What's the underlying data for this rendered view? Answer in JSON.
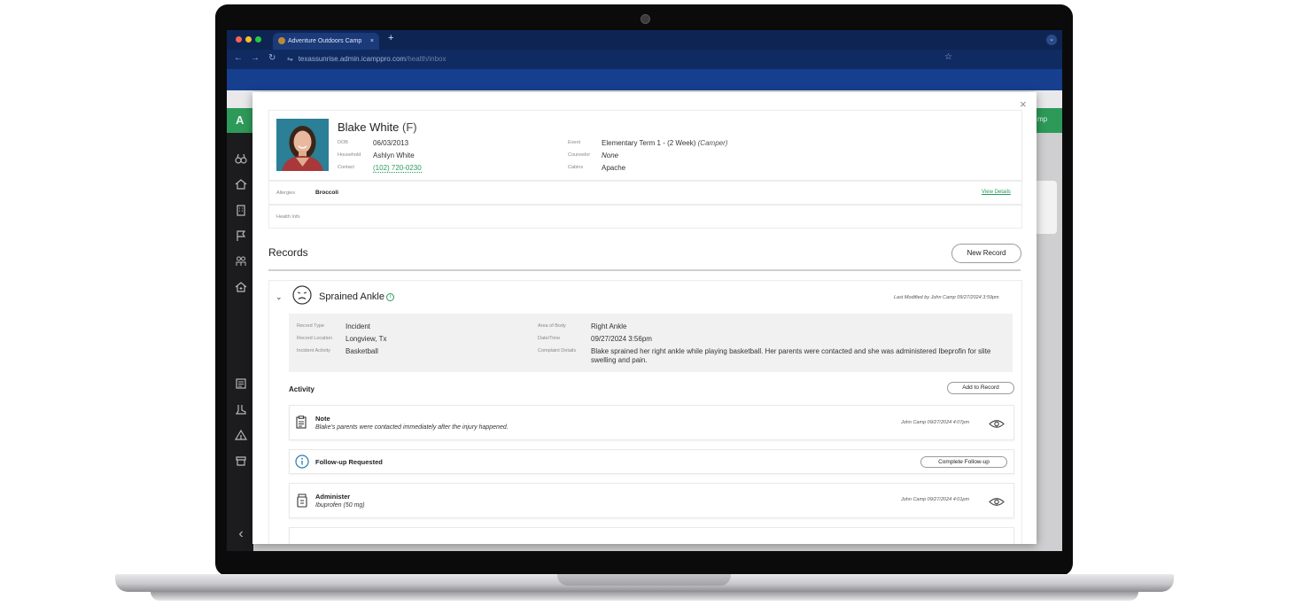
{
  "browser": {
    "tab_title": "Adventure Outdoors Camp",
    "tab_close": "×",
    "new_tab": "+",
    "tab_menu": "⌄",
    "url_host": "texassunrise.admin.icamppro.com",
    "url_path": "/health/inbox",
    "back": "←",
    "forward": "→",
    "reload": "↻",
    "site_info": "⇋",
    "bookmark": "☆"
  },
  "app": {
    "logo_text": "A",
    "header_right": "mp"
  },
  "modal": {
    "close_label": "×",
    "camper": {
      "name": "Blake White",
      "gender": "(F)",
      "dob_label": "DOB",
      "dob": "06/03/2013",
      "household_label": "Household",
      "household": "Ashlyn White",
      "contact_label": "Contact",
      "contact": "(102) 720-0230",
      "event_label": "Event",
      "event": "Elementary Term 1 - (2 Week)",
      "event_role": "(Camper)",
      "counselor_label": "Counselor",
      "counselor": "None",
      "cabins_label": "Cabins",
      "cabins": "Apache"
    },
    "allergies": {
      "label": "Allergies",
      "value": "Broccoli",
      "link": "View Details"
    },
    "health_info_label": "Health Info",
    "records_title": "Records",
    "new_record_label": "New Record",
    "record": {
      "chevron": "⌄",
      "title": "Sprained Ankle",
      "info": "i",
      "last_modified": "Last Modified by John Camp  09/27/2024 3:59pm",
      "fields": {
        "record_type_label": "Record Type",
        "record_type": "Incident",
        "record_location_label": "Record Location",
        "record_location": "Longview, Tx",
        "incident_activity_label": "Incident Activity",
        "incident_activity": "Basketball",
        "area_of_body_label": "Area of Body",
        "area_of_body": "Right Ankle",
        "datetime_label": "Date/Time",
        "datetime": "09/27/2024 3:56pm",
        "complaint_label": "Complaint Details",
        "complaint": "Blake sprained her right ankle while playing basketball. Her parents were contacted and she was administered Ibeprofin for slite swelling and pain."
      },
      "activity_label": "Activity",
      "add_to_record_label": "Add to Record",
      "activities": [
        {
          "title": "Note",
          "subtitle": "Blake's parents were contacted immediately after the injury happened.",
          "meta": "John Camp  09/27/2024 4:07pm"
        },
        {
          "title": "Follow-up Requested",
          "button": "Complete Follow-up"
        },
        {
          "title": "Administer",
          "subtitle": "Ibuprofen (50 mg)",
          "meta": "John Camp  09/27/2024 4:01pm"
        }
      ]
    }
  },
  "colors": {
    "browser_chrome": "#0e2553",
    "app_green": "#2e9a59",
    "link_green": "#2a9a5c",
    "info_blue": "#2a7ab0"
  }
}
